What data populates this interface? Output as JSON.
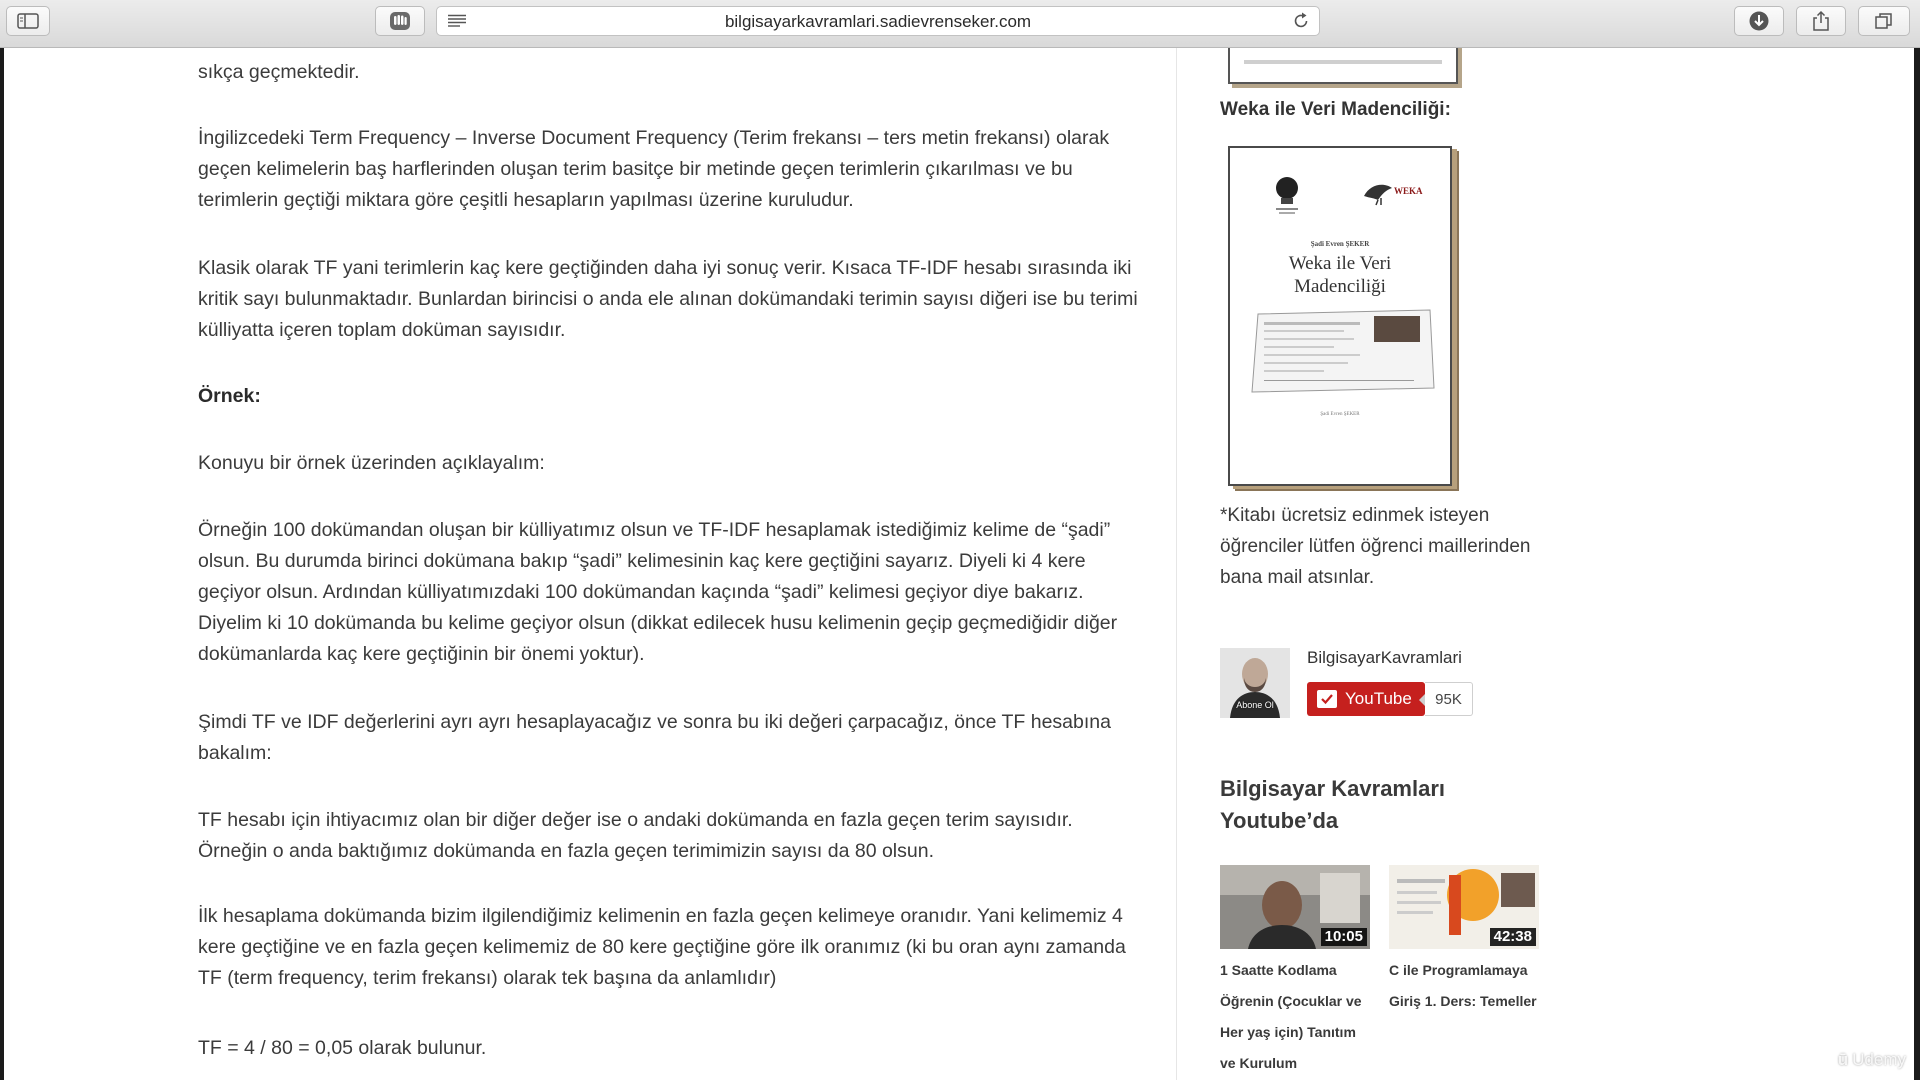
{
  "browser": {
    "url": "bilgisayarkavramlari.sadievrenseker.com"
  },
  "article": {
    "p0": "sıkça geçmektedir.",
    "p1": "İngilizcedeki Term Frequency – Inverse Document Frequency (Terim frekansı – ters metin frekansı) olarak geçen kelimelerin baş harflerinden oluşan terim basitçe bir metinde geçen terimlerin çıkarılması ve bu terimlerin geçtiği miktara göre çeşitli hesapların yapılması üzerine kuruludur.",
    "p2": "Klasik olarak TF yani terimlerin kaç kere geçtiğinden daha iyi sonuç verir. Kısaca TF-IDF hesabı sırasında iki kritik sayı bulunmaktadır. Bunlardan birincisi o anda ele alınan dokümandaki terimin sayısı diğeri ise bu terimi külliyatta içeren toplam doküman sayısıdır.",
    "heading": "Örnek:",
    "p3": "Konuyu bir örnek üzerinden açıklayalım:",
    "p4": "Örneğin 100 dokümandan oluşan bir külliyatımız olsun ve TF-IDF hesaplamak istediğimiz kelime de “şadi” olsun. Bu durumda birinci dokümana bakıp “şadi” kelimesinin kaç kere geçtiğini sayarız. Diyeli ki 4 kere geçiyor olsun. Ardından külliyatımızdaki 100 dokümandan kaçında “şadi” kelimesi geçiyor diye bakarız. Diyelim ki 10 dokümanda bu kelime geçiyor olsun (dikkat edilecek husu kelimenin geçip geçmediğidir diğer dokümanlarda kaç kere geçtiğinin bir önemi yoktur).",
    "p5": "Şimdi TF ve IDF değerlerini ayrı ayrı hesaplayacağız ve sonra bu iki değeri çarpacağız, önce TF hesabına bakalım:",
    "p6": "TF hesabı için ihtiyacımız olan bir diğer değer ise o andaki dokümanda en fazla geçen terim sayısıdır. Örneğin o anda baktığımız dokümanda en fazla geçen terimimizin sayısı da 80 olsun.",
    "p7": "İlk hesaplama dokümanda bizim ilgilendiğimiz kelimenin en fazla geçen kelimeye oranıdır. Yani kelimemiz 4 kere geçtiğine ve en fazla geçen kelimemiz de 80 kere geçtiğine göre ilk oranımız (ki bu oran aynı zamanda TF (term frequency, terim frekansı) olarak tek başına da anlamlıdır)",
    "p8": "TF = 4 / 80 = 0,05 olarak bulunur."
  },
  "sidebar": {
    "weka_title": "Weka ile Veri Madenciliği:",
    "book": {
      "author": "Şadi Evren ŞEKER",
      "name": "Weka ile Veri Madenciliği",
      "logo_text": "WEKA"
    },
    "note": "*Kitabı ücretsiz edinmek isteyen öğrenciler lütfen öğrenci maillerinden bana mail atsınlar.",
    "channel": {
      "name": "BilgisayarKavramlari",
      "avatar_label": "Abone Ol",
      "button_label": "YouTube",
      "subscriber_count": "95K"
    },
    "youtube_title": "Bilgisayar Kavramları Youtube’da",
    "videos": [
      {
        "duration": "10:05",
        "title": "1 Saatte Kodlama Öğrenin (Çocuklar ve Her yaş için) Tanıtım ve Kurulum"
      },
      {
        "duration": "42:38",
        "title": "C ile Programlamaya Giriş 1. Ders: Temeller"
      }
    ]
  },
  "watermark": "Udemy",
  "colors": {
    "youtube_red": "#c5201e",
    "text": "#3b3b3b",
    "toolbar": "#e2e2e2"
  }
}
